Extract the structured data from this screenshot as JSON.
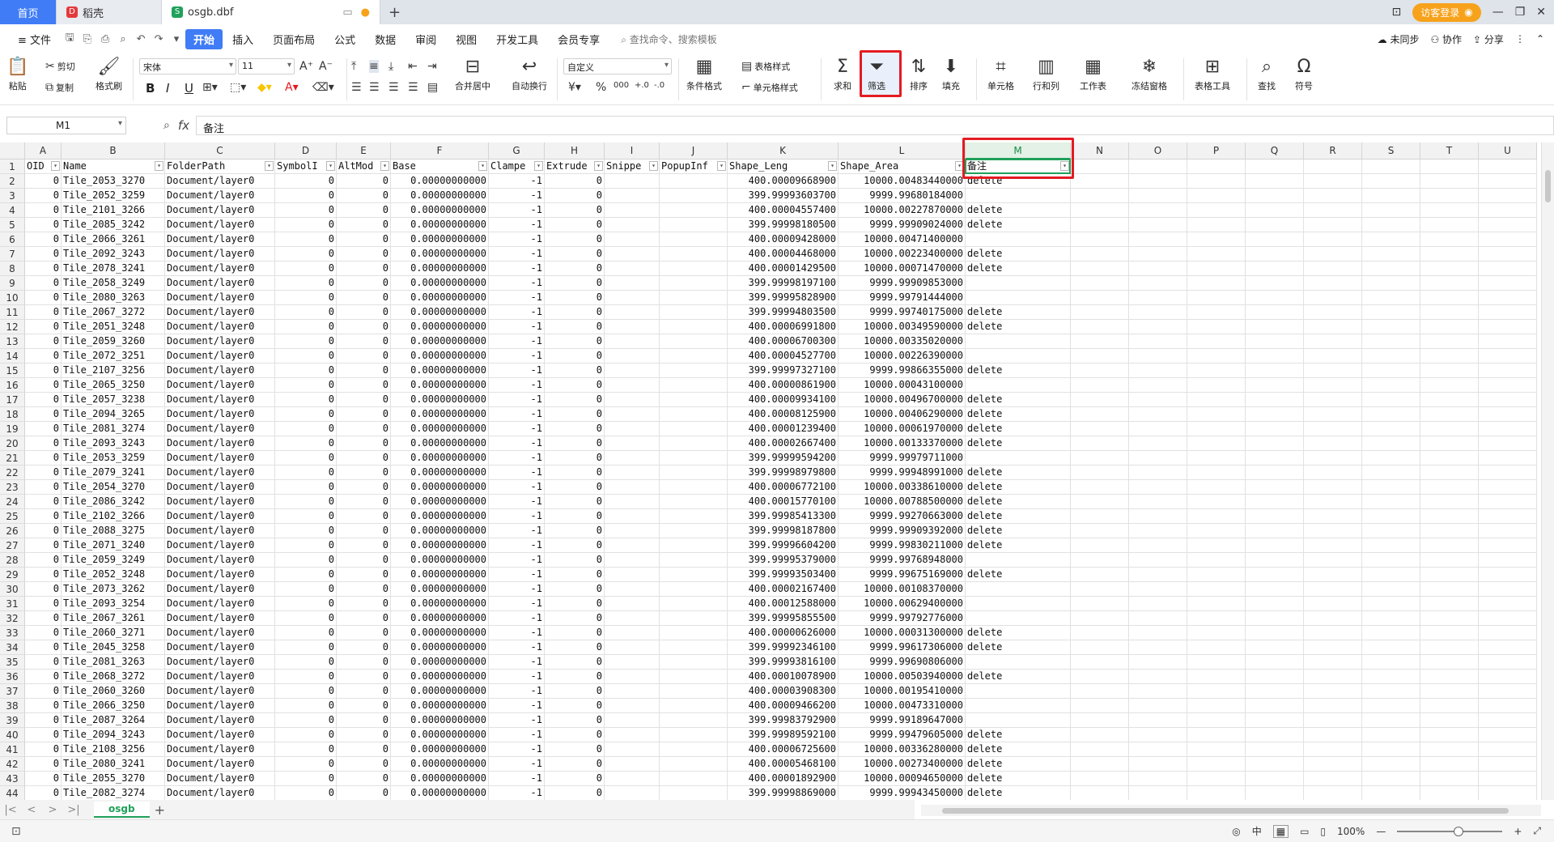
{
  "tabs": {
    "home": "首页",
    "docer": "稻壳",
    "file": "osgb.dbf",
    "add": "+"
  },
  "titlebar": {
    "login": "访客登录"
  },
  "menu": {
    "file": "文件",
    "start": "开始",
    "items": [
      "插入",
      "页面布局",
      "公式",
      "数据",
      "审阅",
      "视图",
      "开发工具",
      "会员专享"
    ],
    "search": "查找命令、搜索模板",
    "right": [
      "未同步",
      "协作",
      "分享"
    ]
  },
  "ribbon": {
    "paste": "粘贴",
    "cut": "剪切",
    "copy": "复制",
    "format_painter": "格式刷",
    "font_name": "宋体",
    "font_size": "11",
    "merge_center": "合并居中",
    "wrap_text": "自动换行",
    "number_format": "自定义",
    "conditional_format": "条件格式",
    "table_style": "表格样式",
    "cell_style": "单元格样式",
    "sum": "求和",
    "filter": "筛选",
    "sort": "排序",
    "fill": "填充",
    "cell": "单元格",
    "row_col": "行和列",
    "worksheet": "工作表",
    "freeze": "冻结窗格",
    "table_tools": "表格工具",
    "find": "查找",
    "symbol": "符号",
    "bold": "B",
    "italic": "I",
    "underline": "U"
  },
  "formula": {
    "cell_ref": "M1",
    "fx": "fx",
    "content": "备注"
  },
  "columns": [
    {
      "letter": "A",
      "header": "OID"
    },
    {
      "letter": "B",
      "header": "Name"
    },
    {
      "letter": "C",
      "header": "FolderPath"
    },
    {
      "letter": "D",
      "header": "SymbolI"
    },
    {
      "letter": "E",
      "header": "AltMod"
    },
    {
      "letter": "F",
      "header": "Base"
    },
    {
      "letter": "G",
      "header": "Clampe"
    },
    {
      "letter": "H",
      "header": "Extrude"
    },
    {
      "letter": "I",
      "header": "Snippe"
    },
    {
      "letter": "J",
      "header": "PopupInf"
    },
    {
      "letter": "K",
      "header": "Shape_Leng"
    },
    {
      "letter": "L",
      "header": "Shape_Area"
    },
    {
      "letter": "M",
      "header": "备注"
    },
    {
      "letter": "N",
      "header": ""
    },
    {
      "letter": "O",
      "header": ""
    },
    {
      "letter": "P",
      "header": ""
    },
    {
      "letter": "Q",
      "header": ""
    },
    {
      "letter": "R",
      "header": ""
    },
    {
      "letter": "S",
      "header": ""
    },
    {
      "letter": "T",
      "header": ""
    },
    {
      "letter": "U",
      "header": ""
    }
  ],
  "rows": [
    [
      "0",
      "Tile_2053_3270",
      "Document/layer0",
      "0",
      "0",
      "0.00000000000",
      "-1",
      "0",
      "400.00009668900",
      "10000.00483440000",
      "delete"
    ],
    [
      "0",
      "Tile_2052_3259",
      "Document/layer0",
      "0",
      "0",
      "0.00000000000",
      "-1",
      "0",
      "399.99993603700",
      "9999.99680184000",
      ""
    ],
    [
      "0",
      "Tile_2101_3266",
      "Document/layer0",
      "0",
      "0",
      "0.00000000000",
      "-1",
      "0",
      "400.00004557400",
      "10000.00227870000",
      "delete"
    ],
    [
      "0",
      "Tile_2085_3242",
      "Document/layer0",
      "0",
      "0",
      "0.00000000000",
      "-1",
      "0",
      "399.99998180500",
      "9999.99909024000",
      "delete"
    ],
    [
      "0",
      "Tile_2066_3261",
      "Document/layer0",
      "0",
      "0",
      "0.00000000000",
      "-1",
      "0",
      "400.00009428000",
      "10000.00471400000",
      ""
    ],
    [
      "0",
      "Tile_2092_3243",
      "Document/layer0",
      "0",
      "0",
      "0.00000000000",
      "-1",
      "0",
      "400.00004468000",
      "10000.00223400000",
      "delete"
    ],
    [
      "0",
      "Tile_2078_3241",
      "Document/layer0",
      "0",
      "0",
      "0.00000000000",
      "-1",
      "0",
      "400.00001429500",
      "10000.00071470000",
      "delete"
    ],
    [
      "0",
      "Tile_2058_3249",
      "Document/layer0",
      "0",
      "0",
      "0.00000000000",
      "-1",
      "0",
      "399.99998197100",
      "9999.99909853000",
      ""
    ],
    [
      "0",
      "Tile_2080_3263",
      "Document/layer0",
      "0",
      "0",
      "0.00000000000",
      "-1",
      "0",
      "399.99995828900",
      "9999.99791444000",
      ""
    ],
    [
      "0",
      "Tile_2067_3272",
      "Document/layer0",
      "0",
      "0",
      "0.00000000000",
      "-1",
      "0",
      "399.99994803500",
      "9999.99740175000",
      "delete"
    ],
    [
      "0",
      "Tile_2051_3248",
      "Document/layer0",
      "0",
      "0",
      "0.00000000000",
      "-1",
      "0",
      "400.00006991800",
      "10000.00349590000",
      "delete"
    ],
    [
      "0",
      "Tile_2059_3260",
      "Document/layer0",
      "0",
      "0",
      "0.00000000000",
      "-1",
      "0",
      "400.00006700300",
      "10000.00335020000",
      ""
    ],
    [
      "0",
      "Tile_2072_3251",
      "Document/layer0",
      "0",
      "0",
      "0.00000000000",
      "-1",
      "0",
      "400.00004527700",
      "10000.00226390000",
      ""
    ],
    [
      "0",
      "Tile_2107_3256",
      "Document/layer0",
      "0",
      "0",
      "0.00000000000",
      "-1",
      "0",
      "399.99997327100",
      "9999.99866355000",
      "delete"
    ],
    [
      "0",
      "Tile_2065_3250",
      "Document/layer0",
      "0",
      "0",
      "0.00000000000",
      "-1",
      "0",
      "400.00000861900",
      "10000.00043100000",
      ""
    ],
    [
      "0",
      "Tile_2057_3238",
      "Document/layer0",
      "0",
      "0",
      "0.00000000000",
      "-1",
      "0",
      "400.00009934100",
      "10000.00496700000",
      "delete"
    ],
    [
      "0",
      "Tile_2094_3265",
      "Document/layer0",
      "0",
      "0",
      "0.00000000000",
      "-1",
      "0",
      "400.00008125900",
      "10000.00406290000",
      "delete"
    ],
    [
      "0",
      "Tile_2081_3274",
      "Document/layer0",
      "0",
      "0",
      "0.00000000000",
      "-1",
      "0",
      "400.00001239400",
      "10000.00061970000",
      "delete"
    ],
    [
      "0",
      "Tile_2093_3243",
      "Document/layer0",
      "0",
      "0",
      "0.00000000000",
      "-1",
      "0",
      "400.00002667400",
      "10000.00133370000",
      "delete"
    ],
    [
      "0",
      "Tile_2053_3259",
      "Document/layer0",
      "0",
      "0",
      "0.00000000000",
      "-1",
      "0",
      "399.99999594200",
      "9999.99979711000",
      ""
    ],
    [
      "0",
      "Tile_2079_3241",
      "Document/layer0",
      "0",
      "0",
      "0.00000000000",
      "-1",
      "0",
      "399.99998979800",
      "9999.99948991000",
      "delete"
    ],
    [
      "0",
      "Tile_2054_3270",
      "Document/layer0",
      "0",
      "0",
      "0.00000000000",
      "-1",
      "0",
      "400.00006772100",
      "10000.00338610000",
      "delete"
    ],
    [
      "0",
      "Tile_2086_3242",
      "Document/layer0",
      "0",
      "0",
      "0.00000000000",
      "-1",
      "0",
      "400.00015770100",
      "10000.00788500000",
      "delete"
    ],
    [
      "0",
      "Tile_2102_3266",
      "Document/layer0",
      "0",
      "0",
      "0.00000000000",
      "-1",
      "0",
      "399.99985413300",
      "9999.99270663000",
      "delete"
    ],
    [
      "0",
      "Tile_2088_3275",
      "Document/layer0",
      "0",
      "0",
      "0.00000000000",
      "-1",
      "0",
      "399.99998187800",
      "9999.99909392000",
      "delete"
    ],
    [
      "0",
      "Tile_2071_3240",
      "Document/layer0",
      "0",
      "0",
      "0.00000000000",
      "-1",
      "0",
      "399.99996604200",
      "9999.99830211000",
      "delete"
    ],
    [
      "0",
      "Tile_2059_3249",
      "Document/layer0",
      "0",
      "0",
      "0.00000000000",
      "-1",
      "0",
      "399.99995379000",
      "9999.99768948000",
      ""
    ],
    [
      "0",
      "Tile_2052_3248",
      "Document/layer0",
      "0",
      "0",
      "0.00000000000",
      "-1",
      "0",
      "399.99993503400",
      "9999.99675169000",
      "delete"
    ],
    [
      "0",
      "Tile_2073_3262",
      "Document/layer0",
      "0",
      "0",
      "0.00000000000",
      "-1",
      "0",
      "400.00002167400",
      "10000.00108370000",
      ""
    ],
    [
      "0",
      "Tile_2093_3254",
      "Document/layer0",
      "0",
      "0",
      "0.00000000000",
      "-1",
      "0",
      "400.00012588000",
      "10000.00629400000",
      ""
    ],
    [
      "0",
      "Tile_2067_3261",
      "Document/layer0",
      "0",
      "0",
      "0.00000000000",
      "-1",
      "0",
      "399.99995855500",
      "9999.99792776000",
      ""
    ],
    [
      "0",
      "Tile_2060_3271",
      "Document/layer0",
      "0",
      "0",
      "0.00000000000",
      "-1",
      "0",
      "400.00000626000",
      "10000.00031300000",
      "delete"
    ],
    [
      "0",
      "Tile_2045_3258",
      "Document/layer0",
      "0",
      "0",
      "0.00000000000",
      "-1",
      "0",
      "399.99992346100",
      "9999.99617306000",
      "delete"
    ],
    [
      "0",
      "Tile_2081_3263",
      "Document/layer0",
      "0",
      "0",
      "0.00000000000",
      "-1",
      "0",
      "399.99993816100",
      "9999.99690806000",
      ""
    ],
    [
      "0",
      "Tile_2068_3272",
      "Document/layer0",
      "0",
      "0",
      "0.00000000000",
      "-1",
      "0",
      "400.00010078900",
      "10000.00503940000",
      "delete"
    ],
    [
      "0",
      "Tile_2060_3260",
      "Document/layer0",
      "0",
      "0",
      "0.00000000000",
      "-1",
      "0",
      "400.00003908300",
      "10000.00195410000",
      ""
    ],
    [
      "0",
      "Tile_2066_3250",
      "Document/layer0",
      "0",
      "0",
      "0.00000000000",
      "-1",
      "0",
      "400.00009466200",
      "10000.00473310000",
      ""
    ],
    [
      "0",
      "Tile_2087_3264",
      "Document/layer0",
      "0",
      "0",
      "0.00000000000",
      "-1",
      "0",
      "399.99983792900",
      "9999.99189647000",
      ""
    ],
    [
      "0",
      "Tile_2094_3243",
      "Document/layer0",
      "0",
      "0",
      "0.00000000000",
      "-1",
      "0",
      "399.99989592100",
      "9999.99479605000",
      "delete"
    ],
    [
      "0",
      "Tile_2108_3256",
      "Document/layer0",
      "0",
      "0",
      "0.00000000000",
      "-1",
      "0",
      "400.00006725600",
      "10000.00336280000",
      "delete"
    ],
    [
      "0",
      "Tile_2080_3241",
      "Document/layer0",
      "0",
      "0",
      "0.00000000000",
      "-1",
      "0",
      "400.00005468100",
      "10000.00273400000",
      "delete"
    ],
    [
      "0",
      "Tile_2055_3270",
      "Document/layer0",
      "0",
      "0",
      "0.00000000000",
      "-1",
      "0",
      "400.00001892900",
      "10000.00094650000",
      "delete"
    ],
    [
      "0",
      "Tile_2082_3274",
      "Document/layer0",
      "0",
      "0",
      "0.00000000000",
      "-1",
      "0",
      "399.99998869000",
      "9999.99943450000",
      "delete"
    ]
  ],
  "sheet": {
    "name": "osgb",
    "add": "+"
  },
  "status": {
    "ime": "中",
    "zoom": "100%"
  },
  "colors": {
    "accent": "#1fa15a",
    "start_button": "#3f7cf6",
    "highlight": "#e31b23"
  }
}
